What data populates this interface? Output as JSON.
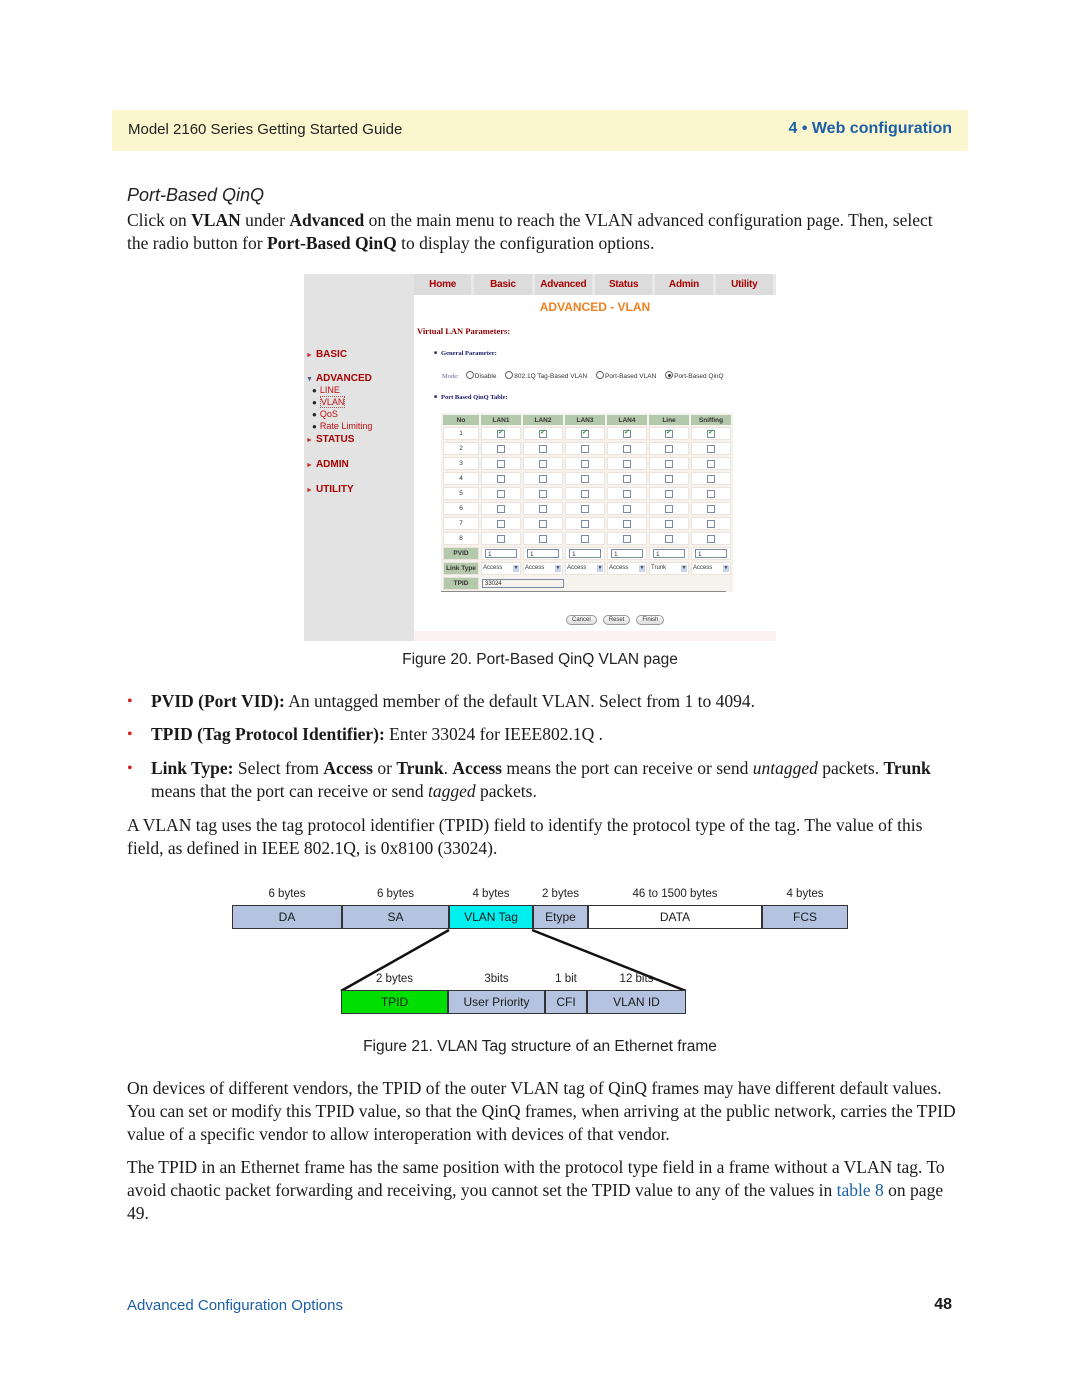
{
  "header": {
    "guide_title": "Model 2160 Series Getting Started Guide",
    "chapter": "4 • Web configuration",
    "accent_color": "#1b5fa8",
    "band_color": "#fbf6cd"
  },
  "section": {
    "title": "Port-Based QinQ",
    "intro": {
      "p1": "Click on ",
      "b1": "VLAN",
      "p2": " under ",
      "b2": "Advanced",
      "p3": " on the main menu to reach the VLAN advanced configuration page. Then, select the radio button for ",
      "b3": "Port-Based QinQ",
      "p4": " to display the configuration options."
    }
  },
  "screenshot": {
    "nav": [
      "Home",
      "Basic",
      "Advanced",
      "Status",
      "Admin",
      "Utility"
    ],
    "page_title": "ADVANCED - VLAN",
    "section_heading": "Virtual LAN Parameters:",
    "general_param_label": "General Parameter:",
    "mode_label": "Mode:",
    "mode_options": [
      {
        "label": "Disable",
        "selected": false
      },
      {
        "label": "802.1Q Tag-Based VLAN",
        "selected": false
      },
      {
        "label": "Port-Based VLAN",
        "selected": false
      },
      {
        "label": "Port-Based QinQ",
        "selected": true
      }
    ],
    "table_label": "Port Based QinQ Table:",
    "sidebar": {
      "basic": "BASIC",
      "advanced": "ADVANCED",
      "advanced_items": [
        "LINE",
        "VLAN",
        "QoS",
        "Rate Limiting"
      ],
      "selected_item": "VLAN",
      "status": "STATUS",
      "admin": "ADMIN",
      "utility": "UTILITY"
    },
    "table": {
      "headers": [
        "No",
        "LAN1",
        "LAN2",
        "LAN3",
        "LAN4",
        "Line",
        "Sniffing"
      ],
      "rows": [
        {
          "no": "1",
          "checked": [
            true,
            true,
            true,
            true,
            true,
            true
          ]
        },
        {
          "no": "2",
          "checked": [
            false,
            false,
            false,
            false,
            false,
            false
          ]
        },
        {
          "no": "3",
          "checked": [
            false,
            false,
            false,
            false,
            false,
            false
          ]
        },
        {
          "no": "4",
          "checked": [
            false,
            false,
            false,
            false,
            false,
            false
          ]
        },
        {
          "no": "5",
          "checked": [
            false,
            false,
            false,
            false,
            false,
            false
          ]
        },
        {
          "no": "6",
          "checked": [
            false,
            false,
            false,
            false,
            false,
            false
          ]
        },
        {
          "no": "7",
          "checked": [
            false,
            false,
            false,
            false,
            false,
            false
          ]
        },
        {
          "no": "8",
          "checked": [
            false,
            false,
            false,
            false,
            false,
            false
          ]
        }
      ],
      "pvid_label": "PVID",
      "pvid_values": [
        "1",
        "1",
        "1",
        "1",
        "1",
        "1"
      ],
      "link_type_label": "Link Type",
      "link_types": [
        "Access",
        "Access",
        "Access",
        "Access",
        "Trunk",
        "Access"
      ],
      "tpid_label": "TPID",
      "tpid_value": "33024"
    },
    "buttons": {
      "cancel": "Cancel",
      "reset": "Reset",
      "finish": "Finish"
    }
  },
  "figure20_caption": "Figure 20. Port-Based QinQ VLAN page",
  "bullets": [
    {
      "bold": "PVID (Port VID):",
      "text": " An untagged member of the default VLAN. Select from 1 to 4094."
    },
    {
      "bold": "TPID (Tag Protocol Identifier):",
      "text": " Enter 33024 for IEEE802.1Q ."
    },
    {
      "bold": "Link Type:",
      "t1": " Select from ",
      "b2": "Access",
      "t2": " or ",
      "b3": "Trunk",
      "t3": ". ",
      "b4": "Access",
      "t4": " means the port can receive or send ",
      "i1": "untagged",
      "t5": " packets. ",
      "b5": "Trunk",
      "t6": " means that the port can receive or send ",
      "i2": "tagged",
      "t7": " packets."
    }
  ],
  "bullet_color": "#d42020",
  "para_vlan_tag": "A VLAN tag uses the tag protocol identifier (TPID) field to identify the protocol type of the tag. The value of this field, as defined in IEEE 802.1Q, is 0x8100 (33024).",
  "diagram": {
    "frame_fields": [
      {
        "size": "6 bytes",
        "name": "DA",
        "color": "#b4c4e0"
      },
      {
        "size": "6 bytes",
        "name": "SA",
        "color": "#b4c4e0"
      },
      {
        "size": "4 bytes",
        "name": "VLAN Tag",
        "color": "#00f0f0"
      },
      {
        "size": "2 bytes",
        "name": "Etype",
        "color": "#b4c4e0"
      },
      {
        "size": "46  to 1500  bytes",
        "name": "DATA",
        "color": "#ffffff"
      },
      {
        "size": "4 bytes",
        "name": "FCS",
        "color": "#b4c4e0"
      }
    ],
    "tag_fields": [
      {
        "size": "2 bytes",
        "name": "TPID",
        "color": "#00e000"
      },
      {
        "size": "3bits",
        "name": "User Priority",
        "color": "#b4c4e0"
      },
      {
        "size": "1 bit",
        "name": "CFI",
        "color": "#b4c4e0"
      },
      {
        "size": "12  bits",
        "name": "VLAN ID",
        "color": "#b4c4e0"
      }
    ]
  },
  "figure21_caption": "Figure 21. VLAN Tag structure of an Ethernet frame",
  "para_vendors": "On devices of different vendors, the TPID of the outer VLAN tag of QinQ frames may have different default values. You can set or modify this TPID value, so that the QinQ frames, when arriving at the public network, carries the TPID value of a specific vendor to allow interoperation with devices of that vendor.",
  "para_position": {
    "text": "The TPID in an Ethernet frame has the same position with the protocol type field in a frame without a VLAN tag. To avoid chaotic packet forwarding and receiving, you cannot set the TPID value to any of the values in ",
    "link": "table 8",
    "tail": " on page 49."
  },
  "footer": {
    "section": "Advanced Configuration Options",
    "page_number": "48"
  }
}
